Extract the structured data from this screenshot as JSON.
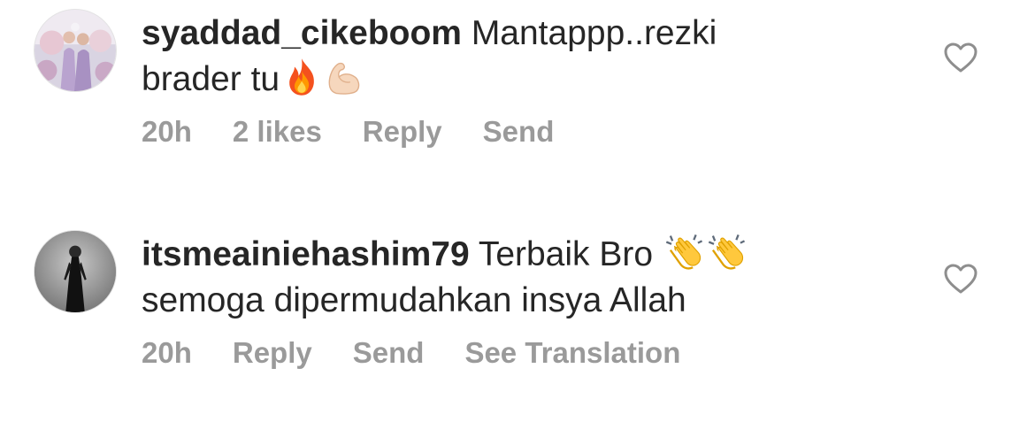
{
  "comments": [
    {
      "username": "syaddad_cikeboom",
      "text": "Mantappp..rezki brader tu",
      "emojis": [
        "fire-emoji",
        "flexed-biceps-emoji"
      ],
      "time": "20h",
      "likes": "2 likes",
      "reply_label": "Reply",
      "send_label": "Send"
    },
    {
      "username": "itsmeainiehashim79",
      "text_line1": "Terbaik Bro",
      "emojis": [
        "clapping-hands-emoji",
        "clapping-hands-emoji"
      ],
      "text_line2": "semoga dipermudahkan insya Allah",
      "time": "20h",
      "reply_label": "Reply",
      "send_label": "Send",
      "translate_label": "See Translation"
    }
  ],
  "colors": {
    "text": "#262626",
    "meta": "#9a9a9a",
    "heart_outline": "#8e8e8e"
  },
  "icons": {
    "like": "heart-outline-icon"
  }
}
